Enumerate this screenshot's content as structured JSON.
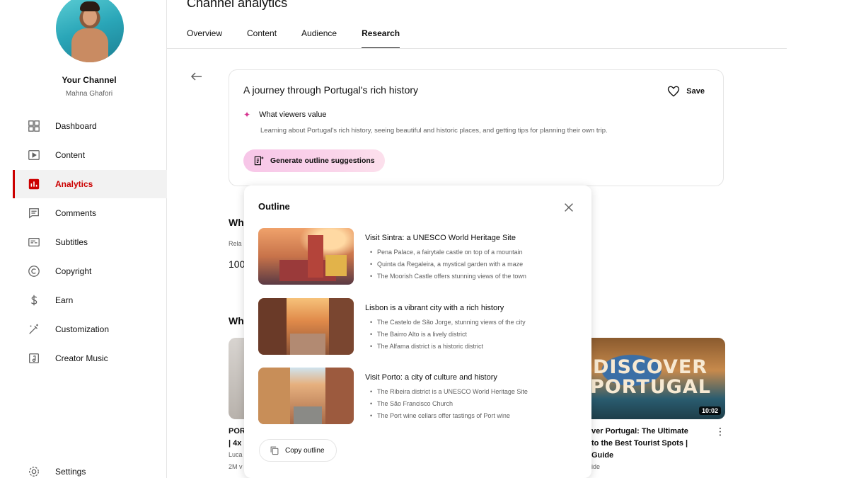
{
  "page": {
    "title": "Channel analytics"
  },
  "tabs": [
    {
      "label": "Overview"
    },
    {
      "label": "Content"
    },
    {
      "label": "Audience"
    },
    {
      "label": "Research",
      "active": true
    }
  ],
  "channel": {
    "name": "Your Channel",
    "handle": "Mahna Ghafori"
  },
  "sidebar": {
    "items": [
      {
        "label": "Dashboard",
        "icon": "dashboard-icon"
      },
      {
        "label": "Content",
        "icon": "content-icon"
      },
      {
        "label": "Analytics",
        "icon": "analytics-icon",
        "active": true
      },
      {
        "label": "Comments",
        "icon": "comments-icon"
      },
      {
        "label": "Subtitles",
        "icon": "subtitles-icon"
      },
      {
        "label": "Copyright",
        "icon": "copyright-icon"
      },
      {
        "label": "Earn",
        "icon": "dollar-icon"
      },
      {
        "label": "Customization",
        "icon": "magic-wand-icon"
      },
      {
        "label": "Creator Music",
        "icon": "music-icon"
      }
    ],
    "settings_label": "Settings"
  },
  "idea": {
    "title": "A journey through Portugal's rich history",
    "save_label": "Save",
    "value_heading": "What viewers value",
    "value_desc": "Learning about Portugal's rich history, seeing beautiful and historic places, and getting tips for planning their own trip.",
    "generate_label": "Generate outline suggestions"
  },
  "outline": {
    "title": "Outline",
    "items": [
      {
        "title": "Visit Sintra: a UNESCO World Heritage Site",
        "bullets": [
          "Pena Palace, a fairytale castle on top of a mountain",
          "Quinta da Regaleira, a mystical garden with a maze",
          "The Moorish Castle offers stunning views of the town"
        ]
      },
      {
        "title": "Lisbon is a vibrant city with a rich history",
        "bullets": [
          "The Castelo de São Jorge, stunning views of the city",
          "The Bairro Alto is a lively district",
          "The Alfama district is a historic district"
        ]
      },
      {
        "title": "Visit Porto: a city of culture and history",
        "bullets": [
          "The Ribeira district is a UNESCO World Heritage Site",
          "The São Francisco Church",
          "The Port wine cellars offer tastings of Port wine"
        ]
      }
    ],
    "copy_label": "Copy outline"
  },
  "background": {
    "heading1": "Wh",
    "sub1": "Rela",
    "num1": "100",
    "heading2": "Wh",
    "left_video": {
      "title_l1": "POR",
      "title_l2": "| 4x",
      "meta1": "Luca",
      "meta2": "2M v"
    },
    "right_video": {
      "thumb_line1": "DISCOVER",
      "thumb_line2": "PORTUGAL",
      "duration": "10:02",
      "title_l1": "ver Portugal: The Ultimate",
      "title_l2": "to the Best Tourist Spots |",
      "title_l3": "Guide",
      "meta": "ide"
    }
  },
  "colors": {
    "accent": "#cc0000",
    "sparkle": "#d6338f"
  }
}
